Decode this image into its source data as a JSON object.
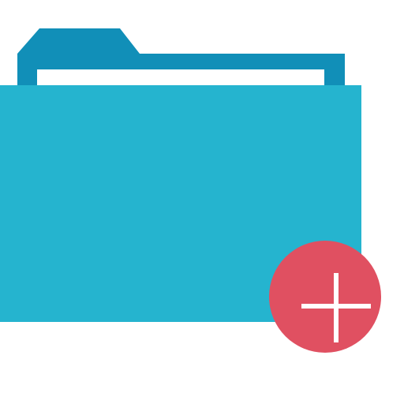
{
  "icon": {
    "name": "add-folder-icon",
    "parts": {
      "folder": "folder-icon",
      "badge": "plus-icon"
    },
    "colors": {
      "folder_back": "#118FB8",
      "folder_front": "#25B4CF",
      "paper": "#FFFFFF",
      "badge": "#E05061",
      "plus": "#FFFFFF",
      "background": "#FFFFFF"
    }
  }
}
